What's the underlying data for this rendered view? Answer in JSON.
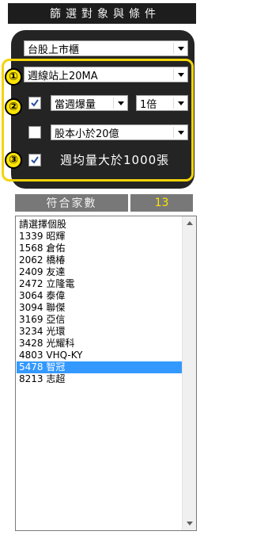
{
  "header": {
    "title": "篩選對象與條件"
  },
  "market_select": {
    "value": "台股上市櫃"
  },
  "criteria": {
    "badges": [
      "①",
      "②",
      "③"
    ],
    "weekly_ma": {
      "value": "週線站上20MA"
    },
    "volume_check": {
      "checked": true
    },
    "volume_select": {
      "value": "當週爆量"
    },
    "multiplier_select": {
      "value": "1倍"
    },
    "capital_check": {
      "checked": false
    },
    "capital_select": {
      "value": "股本小於20億"
    },
    "avgvol_check": {
      "checked": true
    },
    "avgvol_label": "週均量大於1000張"
  },
  "result": {
    "label": "符合家數",
    "count": "13"
  },
  "list": {
    "items": [
      "請選擇個股",
      "1339 昭輝",
      "1568 倉佑",
      "2062 橋椿",
      "2409 友達",
      "2472 立隆電",
      "3064 泰偉",
      "3094 聯傑",
      "3169 亞信",
      "3234 光環",
      "3428 光耀科",
      "4803 VHQ-KY",
      "5478 智冠",
      "8213 志超"
    ],
    "selected_index": 12
  },
  "colors": {
    "highlight": "#f3d40a",
    "badge": "#ffe400",
    "selection": "#3399ff",
    "count": "#ffe400"
  }
}
